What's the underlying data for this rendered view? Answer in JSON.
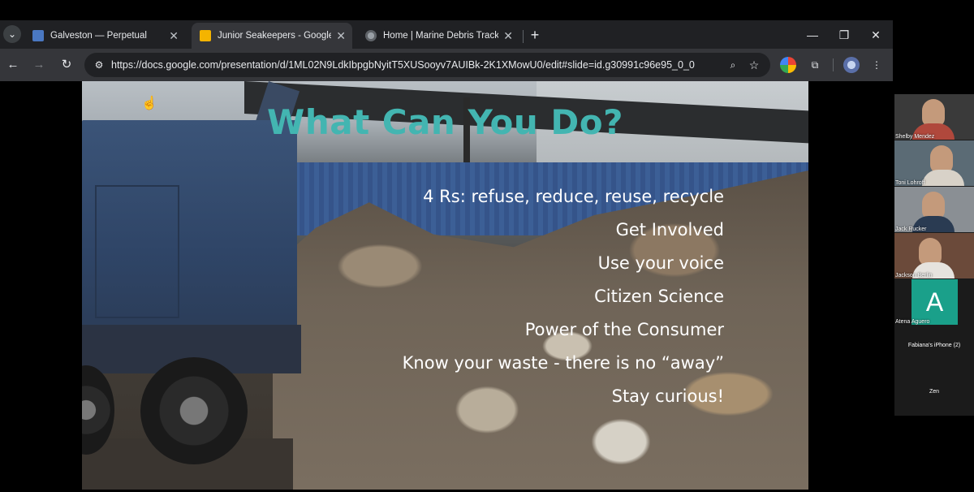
{
  "browser": {
    "tabs": [
      {
        "title": "Galveston — Perpetual",
        "favicon": "docs-blue-icon",
        "active": false
      },
      {
        "title": "Junior Seakeepers - Google Slides",
        "favicon": "slides-icon",
        "active": true
      },
      {
        "title": "Home | Marine Debris Tracker",
        "favicon": "globe-icon",
        "active": false
      }
    ],
    "tab_close": "✕",
    "url": "https://docs.google.com/presentation/d/1ML02N9LdkIbpgbNyitT5XUSooyv7AUIBk-2K1XMowU0/edit#slide=id.g30991c96e95_0_0"
  },
  "slide": {
    "title": "What Can You Do?",
    "title_color": "#43b5b1",
    "bullets": [
      "4 Rs: refuse, reduce, reuse, recycle",
      "Get Involved",
      "Use your voice",
      "Citizen Science",
      "Power of the Consumer",
      "Know your waste - there is no “away”",
      "Stay curious!"
    ]
  },
  "participants": {
    "tiles": [
      {
        "name": "Shelby Mendez"
      },
      {
        "name": "Toni Lohroff"
      },
      {
        "name": "Jack Rucker"
      },
      {
        "name": "Jackson Berlin"
      },
      {
        "name": "Atena Aguero",
        "avatar_letter": "A"
      }
    ],
    "audio_only": [
      {
        "name": "Fabiana's iPhone (2)"
      },
      {
        "name": "Zen"
      }
    ]
  }
}
